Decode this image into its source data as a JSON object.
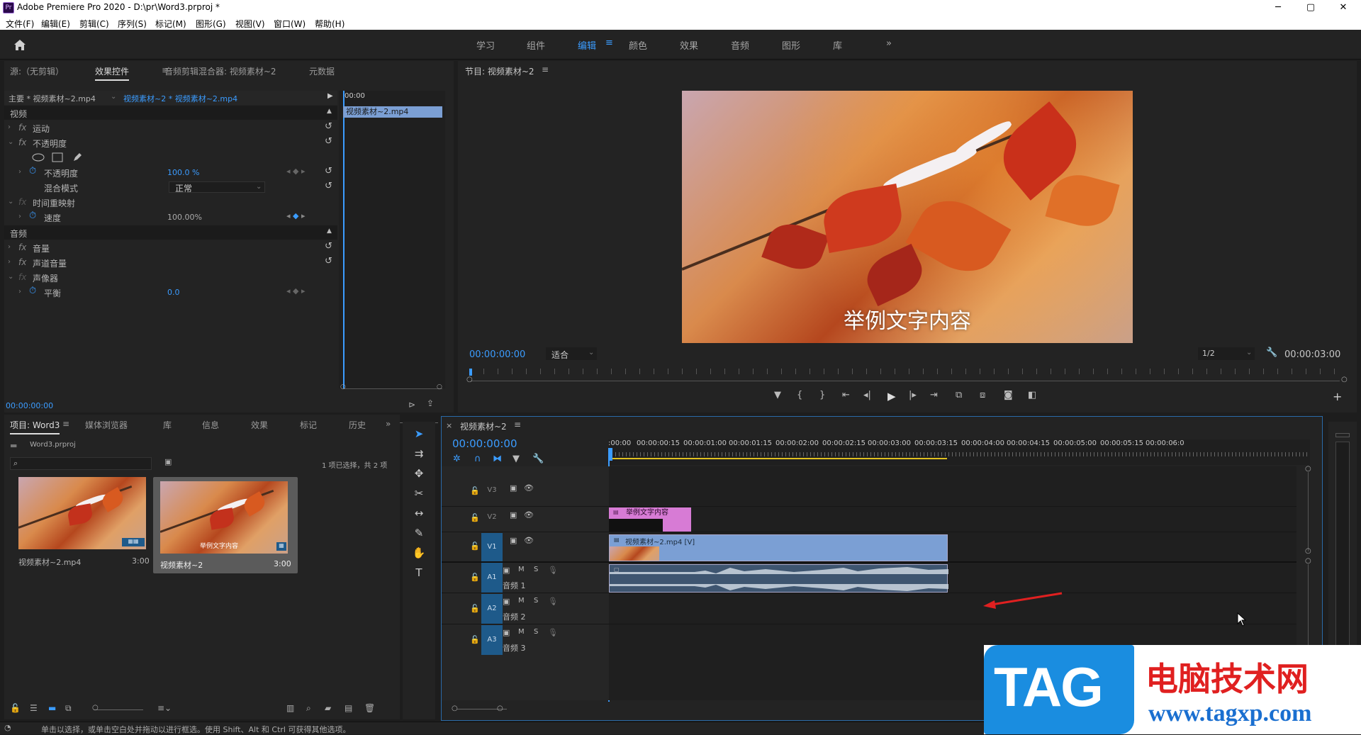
{
  "window": {
    "title": "Adobe Premiere Pro 2020 - D:\\pr\\Word3.prproj *",
    "logo": "Pr",
    "min": "─",
    "max": "▢",
    "close": "✕"
  },
  "menu": [
    "文件(F)",
    "编辑(E)",
    "剪辑(C)",
    "序列(S)",
    "标记(M)",
    "图形(G)",
    "视图(V)",
    "窗口(W)",
    "帮助(H)"
  ],
  "workspaces": {
    "items": [
      "学习",
      "组件",
      "编辑",
      "颜色",
      "效果",
      "音频",
      "图形",
      "库"
    ],
    "active": "编辑",
    "more": "»"
  },
  "effect_controls": {
    "tabs": [
      "源:（无剪辑）",
      "效果控件",
      "音频剪辑混合器: 视频素材~2",
      "元数据"
    ],
    "active_tab": "效果控件",
    "master_clip": "主要 * 视频素材~2.mp4",
    "sequence_clip": "视频素材~2 * 视频素材~2.mp4",
    "mini_timecode": "00:00",
    "mini_clip_label": "视频素材~2.mp4",
    "video_header": "视频",
    "motion": "运动",
    "opacity": "不透明度",
    "opacity_param": "不透明度",
    "opacity_value": "100.0 %",
    "blend_mode_label": "混合模式",
    "blend_mode_value": "正常",
    "time_remap": "时间重映射",
    "speed_label": "速度",
    "speed_value": "100.00%",
    "audio_header": "音频",
    "volume": "音量",
    "channel_volume": "声道音量",
    "panner": "声像器",
    "balance_label": "平衡",
    "balance_value": "0.0",
    "timecode": "00:00:00:00"
  },
  "program_monitor": {
    "title": "节目: 视频素材~2",
    "caption": "举例文字内容",
    "timecode": "00:00:00:00",
    "fit": "适合",
    "resolution": "1/2",
    "duration": "00:00:03:00"
  },
  "project": {
    "tabs": [
      "项目: Word3",
      "媒体浏览器",
      "库",
      "信息",
      "效果",
      "标记",
      "历史"
    ],
    "active_tab": "项目: Word3",
    "file": "Word3.prproj",
    "search_placeholder": "",
    "selection_info": "1 项已选择，共 2 项",
    "items": [
      {
        "name": "视频素材~2.mp4",
        "duration": "3:00",
        "caption": ""
      },
      {
        "name": "视频素材~2",
        "duration": "3:00",
        "caption": "举例文字内容"
      }
    ]
  },
  "timeline": {
    "title": "视频素材~2",
    "timecode": "00:00:00:00",
    "ruler": [
      ":00:00",
      "00:00:00:15",
      "00:00:01:00",
      "00:00:01:15",
      "00:00:02:00",
      "00:00:02:15",
      "00:00:03:00",
      "00:00:03:15",
      "00:00:04:00",
      "00:00:04:15",
      "00:00:05:00",
      "00:00:05:15",
      "00:00:06:0"
    ],
    "tracks": [
      {
        "label": "V3",
        "name": ""
      },
      {
        "label": "V2",
        "name": ""
      },
      {
        "label": "V1",
        "name": ""
      },
      {
        "label": "A1",
        "name": "音频 1"
      },
      {
        "label": "A2",
        "name": "音频 2"
      },
      {
        "label": "A3",
        "name": "音频 3"
      }
    ],
    "text_clip": "举例文字内容",
    "video_clip": "视频素材~2.mp4 [V]",
    "mute": "M",
    "solo": "S"
  },
  "status_bar": "单击以选择，或单击空白处并拖动以进行框选。使用 Shift、Alt 和 Ctrl 可获得其他选项。",
  "watermark": {
    "tag": "TAG",
    "site_name": "电脑技术网",
    "url": "www.tagxp.com"
  },
  "colors": {
    "accent": "#3b9cff",
    "clip_video": "#7b9fd4",
    "clip_text": "#d77bd5",
    "track_label": "#1e5a8a",
    "arrow": "#e02020"
  }
}
